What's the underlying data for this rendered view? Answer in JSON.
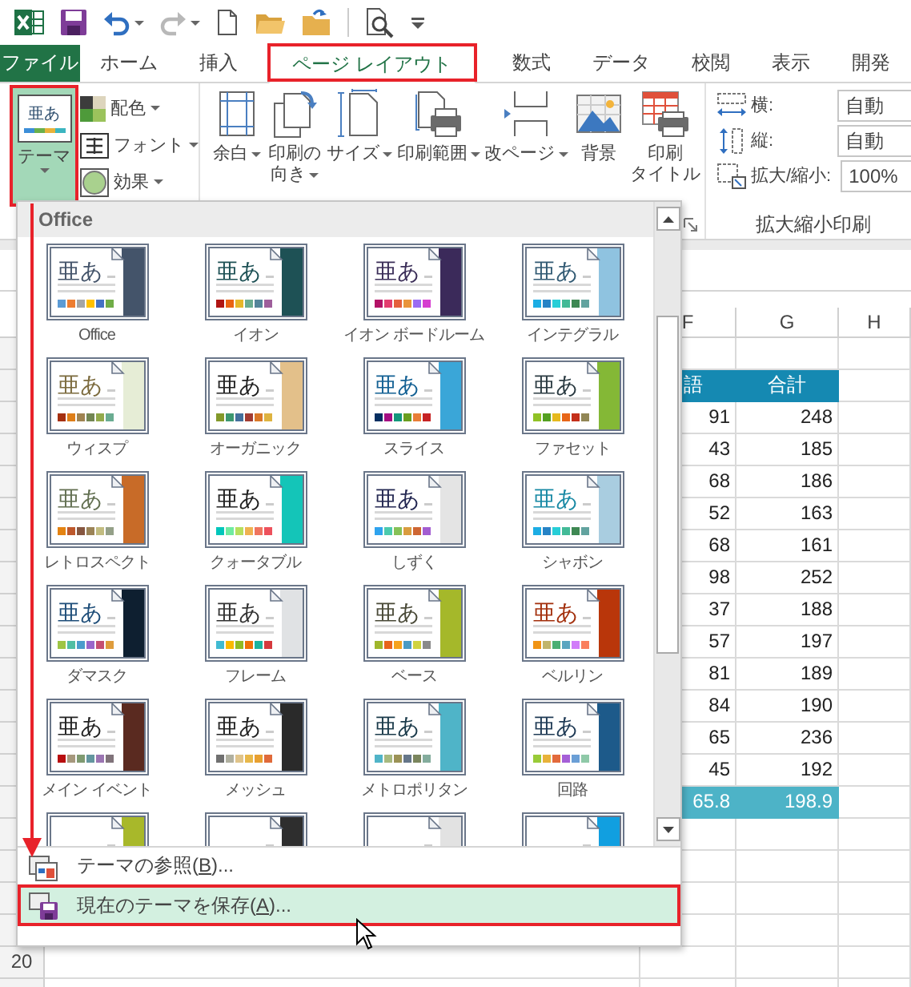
{
  "quick_access": [
    {
      "kind": "app",
      "disabled": false
    },
    {
      "kind": "save",
      "disabled": false
    },
    {
      "kind": "undo",
      "disabled": false
    },
    {
      "kind": "redo",
      "disabled": true
    },
    {
      "kind": "new",
      "disabled": false
    },
    {
      "kind": "open",
      "disabled": false
    },
    {
      "kind": "recent",
      "disabled": false
    },
    {
      "kind": "preview",
      "disabled": false
    },
    {
      "kind": "customize",
      "disabled": false
    }
  ],
  "tabs": [
    {
      "label": "ファイル",
      "kind": "file",
      "selected": false
    },
    {
      "label": "ホーム",
      "kind": "tab",
      "selected": false
    },
    {
      "label": "挿入",
      "kind": "tab",
      "selected": false
    },
    {
      "label": "ページ レイアウト",
      "kind": "tab",
      "selected": true
    },
    {
      "label": "数式",
      "kind": "tab",
      "selected": false
    },
    {
      "label": "データ",
      "kind": "tab",
      "selected": false
    },
    {
      "label": "校閲",
      "kind": "tab",
      "selected": false
    },
    {
      "label": "表示",
      "kind": "tab",
      "selected": false
    },
    {
      "label": "開発",
      "kind": "tab",
      "selected": false
    }
  ],
  "ribbon": {
    "theme_button": {
      "label": "テーマ",
      "sample": "亜あ",
      "expanded": true
    },
    "theme_options": [
      {
        "kind": "colors",
        "label": "配色"
      },
      {
        "kind": "fonts",
        "label": "フォント"
      },
      {
        "kind": "effects",
        "label": "効果"
      }
    ],
    "page_setup": [
      {
        "kind": "margins",
        "lines": [
          "余白"
        ],
        "dropdown": true
      },
      {
        "kind": "orientation",
        "lines": [
          "印刷の",
          "向き"
        ],
        "dropdown": true
      },
      {
        "kind": "size",
        "lines": [
          "サイズ"
        ],
        "dropdown": true
      },
      {
        "kind": "print_area",
        "lines": [
          "印刷範囲"
        ],
        "dropdown": true
      },
      {
        "kind": "breaks",
        "lines": [
          "改ページ"
        ],
        "dropdown": true
      },
      {
        "kind": "background",
        "lines": [
          "背景"
        ],
        "dropdown": false
      },
      {
        "kind": "print_titles",
        "lines": [
          "印刷",
          "タイトル"
        ],
        "dropdown": false
      }
    ],
    "scale": {
      "rows": [
        {
          "kind": "width",
          "label": "横:",
          "value": "自動"
        },
        {
          "kind": "height",
          "label": "縦:",
          "value": "自動"
        },
        {
          "kind": "scale",
          "label": "拡大/縮小:",
          "value": "100%"
        }
      ],
      "title": "拡大縮小印刷"
    }
  },
  "theme_gallery": {
    "section": "Office",
    "themes": [
      {
        "name": "Office",
        "sample": {
          "text": "亜あ",
          "color": "#44546a"
        },
        "color": "#44546a",
        "palette": [
          {
            "color": "#5b9bd5"
          },
          {
            "color": "#ed7d31"
          },
          {
            "color": "#a5a5a5"
          },
          {
            "color": "#ffc000"
          },
          {
            "color": "#4472c4"
          },
          {
            "color": "#70ad47"
          }
        ]
      },
      {
        "name": "イオン",
        "sample": {
          "text": "亜あ",
          "color": "#1e5155"
        },
        "color": "#1e5155",
        "palette": [
          {
            "color": "#b01513"
          },
          {
            "color": "#ea6312"
          },
          {
            "color": "#e6b729"
          },
          {
            "color": "#6aac90"
          },
          {
            "color": "#54849a"
          },
          {
            "color": "#9e5e9b"
          }
        ]
      },
      {
        "name": "イオン ボードルーム",
        "sample": {
          "text": "亜あ",
          "color": "#3b2e58"
        },
        "color": "#3b2a5a",
        "palette": [
          {
            "color": "#b31166"
          },
          {
            "color": "#e33d6f"
          },
          {
            "color": "#e45f3c"
          },
          {
            "color": "#e9943a"
          },
          {
            "color": "#9b6bf2"
          },
          {
            "color": "#d53dd0"
          }
        ]
      },
      {
        "name": "インテグラル",
        "sample": {
          "text": "亜あ",
          "color": "#335b74"
        },
        "color": "#8fc3e0",
        "palette": [
          {
            "color": "#1cade4"
          },
          {
            "color": "#2683c6"
          },
          {
            "color": "#27ced7"
          },
          {
            "color": "#42ba97"
          },
          {
            "color": "#3e8853"
          },
          {
            "color": "#62a39f"
          }
        ]
      },
      {
        "name": "ウィスプ",
        "sample": {
          "text": "亜あ",
          "color": "#7c6b3e"
        },
        "color": "#e6edd6",
        "palette": [
          {
            "color": "#a53010"
          },
          {
            "color": "#de7e18"
          },
          {
            "color": "#9f8351"
          },
          {
            "color": "#728653"
          },
          {
            "color": "#92aa4c"
          },
          {
            "color": "#6aac91"
          }
        ]
      },
      {
        "name": "オーガニック",
        "sample": {
          "text": "亜あ",
          "color": "#212121"
        },
        "color": "#e3c08a",
        "palette": [
          {
            "color": "#83992a"
          },
          {
            "color": "#3c9770"
          },
          {
            "color": "#44709d"
          },
          {
            "color": "#a23c33"
          },
          {
            "color": "#d97828"
          },
          {
            "color": "#deb340"
          }
        ]
      },
      {
        "name": "スライス",
        "sample": {
          "text": "亜あ",
          "color": "#146194"
        },
        "color": "#3aa6d8",
        "palette": [
          {
            "color": "#052f61"
          },
          {
            "color": "#a50e82"
          },
          {
            "color": "#14967c"
          },
          {
            "color": "#6a9e1f"
          },
          {
            "color": "#e87d37"
          },
          {
            "color": "#c62324"
          }
        ]
      },
      {
        "name": "ファセット",
        "sample": {
          "text": "亜あ",
          "color": "#2c3c43"
        },
        "color": "#84b836",
        "palette": [
          {
            "color": "#90c226"
          },
          {
            "color": "#54a021"
          },
          {
            "color": "#e6b91e"
          },
          {
            "color": "#e76618"
          },
          {
            "color": "#c42f1a"
          },
          {
            "color": "#918655"
          }
        ]
      },
      {
        "name": "レトロスペクト",
        "sample": {
          "text": "亜あ",
          "color": "#637052"
        },
        "color": "#c86b28",
        "palette": [
          {
            "color": "#e48312"
          },
          {
            "color": "#bd582c"
          },
          {
            "color": "#865640"
          },
          {
            "color": "#9b8357"
          },
          {
            "color": "#c2bc80"
          },
          {
            "color": "#94a088"
          }
        ]
      },
      {
        "name": "クォータブル",
        "sample": {
          "text": "亜あ",
          "color": "#212121"
        },
        "color": "#14c5b8",
        "palette": [
          {
            "color": "#00c6bb"
          },
          {
            "color": "#6feba0"
          },
          {
            "color": "#b6df5e"
          },
          {
            "color": "#efb251"
          },
          {
            "color": "#ef755f"
          },
          {
            "color": "#ed515c"
          }
        ]
      },
      {
        "name": "しずく",
        "sample": {
          "text": "亜あ",
          "color": "#242852"
        },
        "color": "#e4e4e4",
        "palette": [
          {
            "color": "#2fa3ee"
          },
          {
            "color": "#4bcaad"
          },
          {
            "color": "#86c157"
          },
          {
            "color": "#d99c3f"
          },
          {
            "color": "#ce6633"
          },
          {
            "color": "#a35dd1"
          }
        ]
      },
      {
        "name": "シャボン",
        "sample": {
          "text": "亜あ",
          "color": "#1a8aa5"
        },
        "color": "#a9cde0",
        "palette": [
          {
            "color": "#1cade4"
          },
          {
            "color": "#2683c6"
          },
          {
            "color": "#27ced7"
          },
          {
            "color": "#42ba97"
          },
          {
            "color": "#3e8853"
          },
          {
            "color": "#62a39f"
          }
        ]
      },
      {
        "name": "ダマスク",
        "sample": {
          "text": "亜あ",
          "color": "#1f4e79"
        },
        "color": "#0e1f30",
        "palette": [
          {
            "color": "#9ec544"
          },
          {
            "color": "#50bea3"
          },
          {
            "color": "#4a9ccc"
          },
          {
            "color": "#9a66ca"
          },
          {
            "color": "#c54f71"
          },
          {
            "color": "#de9c3c"
          }
        ]
      },
      {
        "name": "フレーム",
        "sample": {
          "text": "亜あ",
          "color": "#333333"
        },
        "color": "#e0e2e4",
        "palette": [
          {
            "color": "#40bad2"
          },
          {
            "color": "#fab900"
          },
          {
            "color": "#90bb23"
          },
          {
            "color": "#ee7008"
          },
          {
            "color": "#1ab39f"
          },
          {
            "color": "#d5393d"
          }
        ]
      },
      {
        "name": "ベース",
        "sample": {
          "text": "亜あ",
          "color": "#4a4a38"
        },
        "color": "#a5b82a",
        "palette": [
          {
            "color": "#9fb62b"
          },
          {
            "color": "#e8641b"
          },
          {
            "color": "#f6a21d"
          },
          {
            "color": "#4a9bc4"
          },
          {
            "color": "#d0d340"
          },
          {
            "color": "#8a8a8a"
          }
        ]
      },
      {
        "name": "ベルリン",
        "sample": {
          "text": "亜あ",
          "color": "#a3300d"
        },
        "color": "#b9360a",
        "palette": [
          {
            "color": "#f09415"
          },
          {
            "color": "#c1b56b"
          },
          {
            "color": "#4baf73"
          },
          {
            "color": "#5aa6c0"
          },
          {
            "color": "#d17df9"
          },
          {
            "color": "#fa7e5c"
          }
        ]
      },
      {
        "name": "メイン イベント",
        "sample": {
          "text": "亜あ",
          "color": "#222222"
        },
        "color": "#5a2a20",
        "palette": [
          {
            "color": "#b80e0f"
          },
          {
            "color": "#a6987d"
          },
          {
            "color": "#7f9a71"
          },
          {
            "color": "#64969f"
          },
          {
            "color": "#9b75b2"
          },
          {
            "color": "#80737a"
          }
        ]
      },
      {
        "name": "メッシュ",
        "sample": {
          "text": "亜あ",
          "color": "#222222"
        },
        "color": "#2a2a2a",
        "palette": [
          {
            "color": "#707070"
          },
          {
            "color": "#b0b0a0"
          },
          {
            "color": "#e0c48a"
          },
          {
            "color": "#e8b84a"
          },
          {
            "color": "#e8a030"
          },
          {
            "color": "#e06a3a"
          }
        ]
      },
      {
        "name": "メトロポリタン",
        "sample": {
          "text": "亜あ",
          "color": "#1a3a4a"
        },
        "color": "#4fb4c8",
        "palette": [
          {
            "color": "#50b4c8"
          },
          {
            "color": "#a8b97f"
          },
          {
            "color": "#9b9256"
          },
          {
            "color": "#657689"
          },
          {
            "color": "#7a855d"
          },
          {
            "color": "#84ac9d"
          }
        ]
      },
      {
        "name": "回路",
        "sample": {
          "text": "亜あ",
          "color": "#1f3a55"
        },
        "color": "#1d5a8a",
        "palette": [
          {
            "color": "#99cb38"
          },
          {
            "color": "#e8b23a"
          },
          {
            "color": "#e26a3c"
          },
          {
            "color": "#a55fd7"
          },
          {
            "color": "#6b9fd6"
          },
          {
            "color": "#8fc9a8"
          }
        ]
      },
      {
        "color": "#a8b82a"
      },
      {
        "color": "#2e2e2e"
      },
      {
        "color": "#e2e2e2"
      },
      {
        "color": "#119fe0"
      }
    ],
    "menu": [
      {
        "before": "テーマの参照(",
        "key": "B",
        "after": ")...",
        "kind": "browse",
        "selected": false
      },
      {
        "before": "現在のテーマを保存(",
        "key": "A",
        "after": ")...",
        "kind": "save",
        "selected": true
      }
    ]
  },
  "sheet": {
    "columns": [
      {
        "label": "F"
      },
      {
        "label": "G"
      },
      {
        "label": "H"
      }
    ],
    "rows": [
      {
        "kind": "blank"
      },
      {
        "kind": "header",
        "cells": [
          "語",
          "合計"
        ]
      },
      {
        "kind": "data",
        "cells": [
          "91",
          "248"
        ]
      },
      {
        "kind": "data",
        "cells": [
          "43",
          "185"
        ]
      },
      {
        "kind": "data",
        "cells": [
          "68",
          "186"
        ]
      },
      {
        "kind": "data",
        "cells": [
          "52",
          "163"
        ]
      },
      {
        "kind": "data",
        "cells": [
          "68",
          "161"
        ]
      },
      {
        "kind": "data",
        "cells": [
          "98",
          "252"
        ]
      },
      {
        "kind": "data",
        "cells": [
          "37",
          "188"
        ]
      },
      {
        "kind": "data",
        "cells": [
          "57",
          "197"
        ]
      },
      {
        "kind": "data",
        "cells": [
          "81",
          "189"
        ]
      },
      {
        "kind": "data",
        "cells": [
          "84",
          "190"
        ]
      },
      {
        "kind": "data",
        "cells": [
          "65",
          "236"
        ]
      },
      {
        "kind": "data",
        "cells": [
          "45",
          "192"
        ]
      },
      {
        "kind": "average",
        "cells": [
          "65.8",
          "198.9"
        ]
      },
      {
        "kind": "blank"
      },
      {
        "kind": "blank"
      },
      {
        "kind": "blank"
      },
      {
        "kind": "blank"
      },
      {
        "kind": "blank",
        "row_header": "20"
      },
      {
        "kind": "blank"
      }
    ]
  }
}
